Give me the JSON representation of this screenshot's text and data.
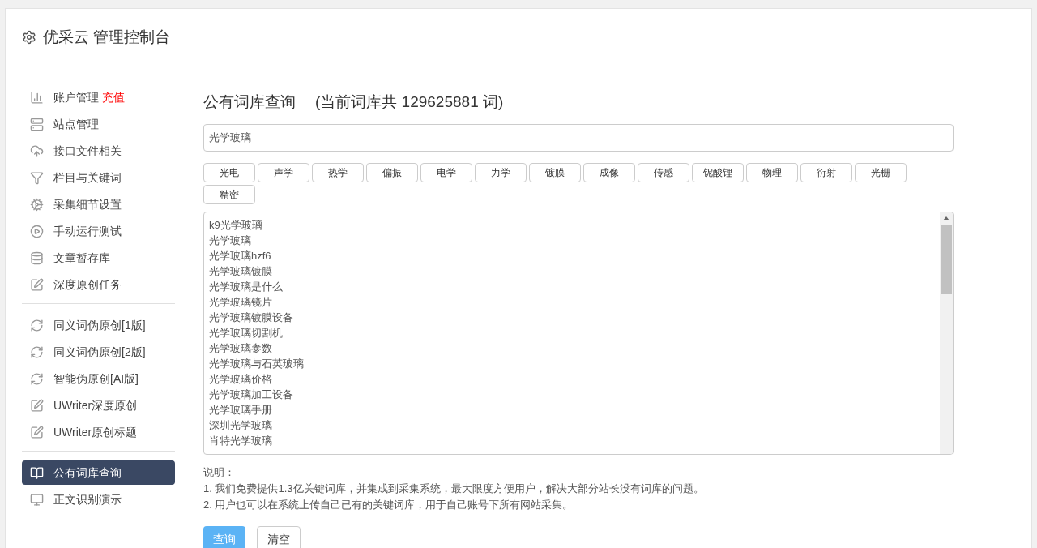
{
  "header": {
    "title": "优采云 管理控制台"
  },
  "sidebar": {
    "groups": [
      {
        "items": [
          {
            "label": "账户管理",
            "badge": "充值",
            "kind": "chart",
            "selected": false
          },
          {
            "label": "站点管理",
            "kind": "server",
            "selected": false
          },
          {
            "label": "接口文件相关",
            "kind": "cloud",
            "selected": false
          },
          {
            "label": "栏目与关键词",
            "kind": "filter",
            "selected": false
          },
          {
            "label": "采集细节设置",
            "kind": "gears",
            "selected": false
          },
          {
            "label": "手动运行测试",
            "kind": "play",
            "selected": false
          },
          {
            "label": "文章暂存库",
            "kind": "database",
            "selected": false
          },
          {
            "label": "深度原创任务",
            "kind": "edit",
            "selected": false
          }
        ]
      },
      {
        "items": [
          {
            "label": "同义词伪原创[1版]",
            "kind": "refresh",
            "selected": false
          },
          {
            "label": "同义词伪原创[2版]",
            "kind": "refresh",
            "selected": false
          },
          {
            "label": "智能伪原创[AI版]",
            "kind": "refresh",
            "selected": false
          },
          {
            "label": "UWriter深度原创",
            "kind": "edit",
            "selected": false
          },
          {
            "label": "UWriter原创标题",
            "kind": "edit",
            "selected": false
          }
        ]
      },
      {
        "items": [
          {
            "label": "公有词库查询",
            "kind": "book",
            "selected": true
          },
          {
            "label": "正文识别演示",
            "kind": "monitor",
            "selected": false
          }
        ]
      }
    ]
  },
  "main": {
    "title": "公有词库查询",
    "count_note": "(当前词库共 129625881 词)",
    "search": {
      "value": "光学玻璃"
    },
    "tags": [
      "光电",
      "声学",
      "热学",
      "偏振",
      "电学",
      "力学",
      "镀膜",
      "成像",
      "传感",
      "铌酸锂",
      "物理",
      "衍射",
      "光栅",
      "精密"
    ],
    "results": [
      "k9光学玻璃",
      "光学玻璃",
      "光学玻璃hzf6",
      "光学玻璃镀膜",
      "光学玻璃是什么",
      "光学玻璃镜片",
      "光学玻璃镀膜设备",
      "光学玻璃切割机",
      "光学玻璃参数",
      "光学玻璃与石英玻璃",
      "光学玻璃价格",
      "光学玻璃加工设备",
      "光学玻璃手册",
      "深圳光学玻璃",
      "肖特光学玻璃"
    ],
    "notes": [
      "说明：",
      "1. 我们免费提供1.3亿关键词库，并集成到采集系统，最大限度方便用户，解决大部分站长没有词库的问题。",
      "2. 用户也可以在系统上传自己已有的关键词库，用于自己账号下所有网站采集。"
    ],
    "buttons": [
      {
        "label": "查询",
        "kind": "primary"
      },
      {
        "label": "清空",
        "kind": "default"
      }
    ]
  }
}
